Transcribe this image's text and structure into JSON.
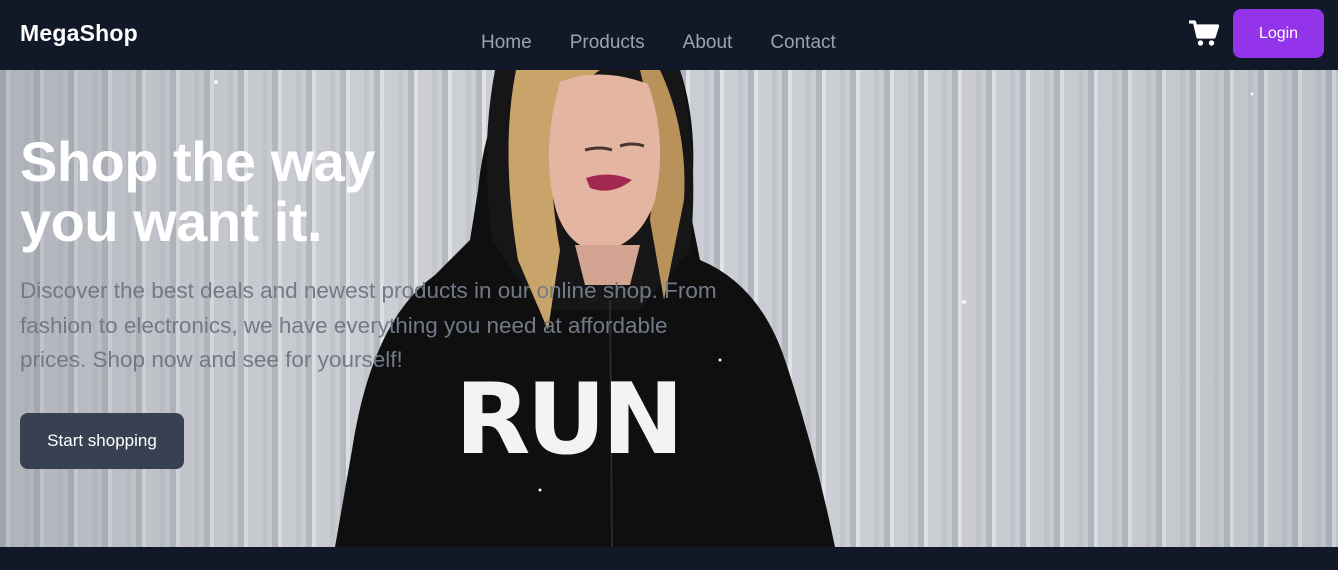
{
  "nav": {
    "brand": "MegaShop",
    "links": [
      "Home",
      "Products",
      "About",
      "Contact"
    ],
    "login_label": "Login",
    "cart_icon": "shopping-cart-icon"
  },
  "hero": {
    "title_line1": "Shop the way",
    "title_line2": "you want it.",
    "text": "Discover the best deals and newest products in our online shop. From fashion to electronics, we have everything you need at affordable prices. Shop now and see for yourself!",
    "cta_label": "Start shopping",
    "image_label": "RUN"
  },
  "colors": {
    "nav_bg": "#111827",
    "accent": "#9333ea",
    "cta_bg": "#374151",
    "body_text": "#727987"
  }
}
